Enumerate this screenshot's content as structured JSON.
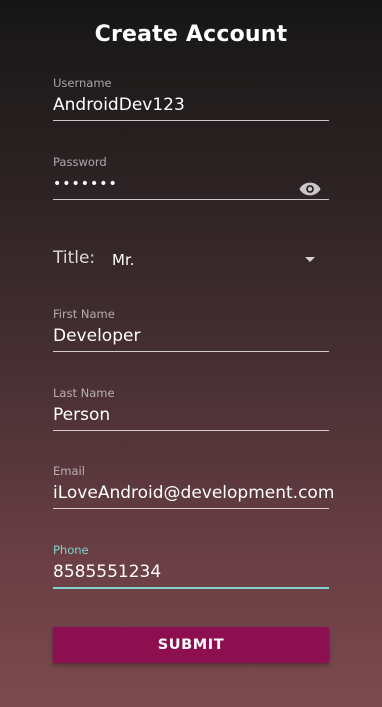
{
  "page": {
    "title": "Create Account"
  },
  "form": {
    "username": {
      "label": "Username",
      "value": "AndroidDev123"
    },
    "password": {
      "label": "Password",
      "value": "•••••••",
      "toggle_icon": "eye-icon"
    },
    "title_select": {
      "label": "Title:",
      "selected": "Mr.",
      "caret_icon": "dropdown-caret-icon"
    },
    "first_name": {
      "label": "First Name",
      "value": "Developer"
    },
    "last_name": {
      "label": "Last Name",
      "value": "Person"
    },
    "email": {
      "label": "Email",
      "value": "iLoveAndroid@development.com"
    },
    "phone": {
      "label": "Phone",
      "value": "8585551234",
      "focused": true
    }
  },
  "actions": {
    "submit_label": "SUBMIT"
  },
  "colors": {
    "accent_focus": "#7fd3cc",
    "submit_button": "#8d0f4f"
  }
}
